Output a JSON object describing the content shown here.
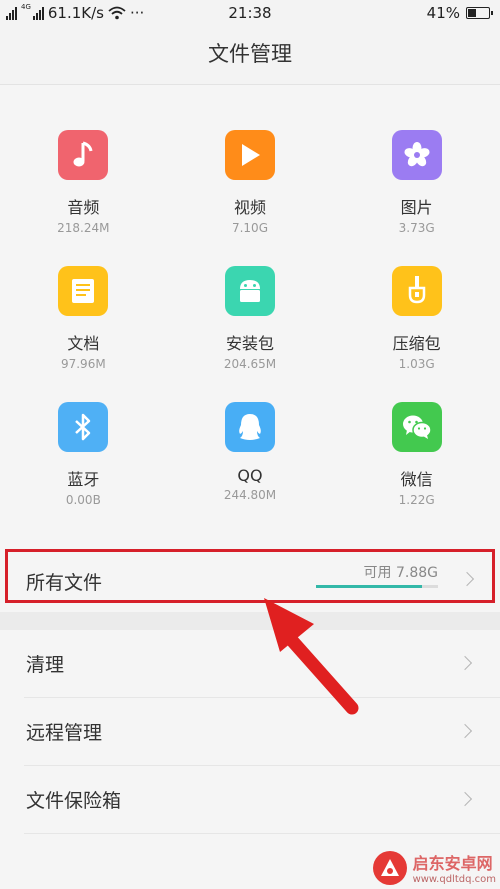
{
  "status_bar": {
    "net_label": "4G",
    "speed": "61.1K/s",
    "more": "···",
    "time": "21:38",
    "battery_percent": "41%",
    "battery_level": 0.41
  },
  "header": {
    "title": "文件管理"
  },
  "categories": [
    {
      "name": "音频",
      "size": "218.24M",
      "icon": "music-note-icon",
      "color": "#f0646e"
    },
    {
      "name": "视频",
      "size": "7.10G",
      "icon": "play-icon",
      "color": "#ff8c19"
    },
    {
      "name": "图片",
      "size": "3.73G",
      "icon": "flower-icon",
      "color": "#9b7cf2"
    },
    {
      "name": "文档",
      "size": "97.96M",
      "icon": "document-icon",
      "color": "#ffc21a"
    },
    {
      "name": "安装包",
      "size": "204.65M",
      "icon": "android-icon",
      "color": "#3bd6b0"
    },
    {
      "name": "压缩包",
      "size": "1.03G",
      "icon": "zip-icon",
      "color": "#ffc21a"
    },
    {
      "name": "蓝牙",
      "size": "0.00B",
      "icon": "bluetooth-icon",
      "color": "#4fb0f5"
    },
    {
      "name": "QQ",
      "size": "244.80M",
      "icon": "qq-icon",
      "color": "#48aef5"
    },
    {
      "name": "微信",
      "size": "1.22G",
      "icon": "wechat-icon",
      "color": "#43c94f"
    }
  ],
  "all_files": {
    "label": "所有文件",
    "free": "可用 7.88G",
    "used_fraction": 0.87,
    "accent": "#33b8a8",
    "highlight_color": "#d6202a"
  },
  "list": [
    {
      "label": "清理"
    },
    {
      "label": "远程管理"
    },
    {
      "label": "文件保险箱"
    }
  ],
  "watermark": {
    "name": "启东安卓网",
    "url": "www.qdltdq.com"
  }
}
